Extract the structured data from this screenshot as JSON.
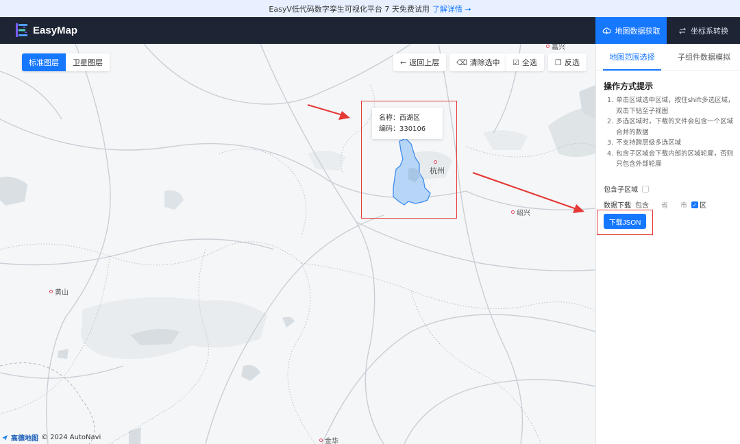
{
  "banner": {
    "text": "EasyV低代码数字孪生可视化平台 7 天免费试用",
    "link": "了解详情 →"
  },
  "app": {
    "name": "EasyMap"
  },
  "topbar": {
    "fetch_label": "地图数据获取",
    "coord_label": "坐标系转换"
  },
  "map": {
    "layers": {
      "standard": "标准图层",
      "satellite": "卫星图层",
      "active": "standard"
    },
    "buttons": {
      "back": "返回上层",
      "clear": "清除选中",
      "select_all": "全选",
      "invert": "反选"
    },
    "tooltip": {
      "name_line": "名称：西湖区",
      "code_line": "编码：330106"
    },
    "places": {
      "hangzhou": "杭州",
      "shaoxing": "绍兴",
      "huangshan": "黄山",
      "jiaxing": "嘉兴",
      "jinhua": "金华"
    },
    "credit": {
      "brand": "高德地图",
      "copyright": "© 2024 AutoNavi"
    }
  },
  "panel": {
    "tabs": [
      "地图范围选择",
      "子组件数据模拟"
    ],
    "active_tab": 0,
    "section_title": "操作方式提示",
    "tips": [
      "单击区域选中区域，按住shift多选区域，双击下钻至子视图",
      "多选区域时，下载的文件会包含一个区域合并的数据",
      "不支持跨层级多选区域",
      "包含子区域会下载内部的区域轮廓，否则只包含外部轮廓"
    ],
    "include_sub_label": "包含子区域",
    "include_sub_checked": false,
    "download_label": "数据下载",
    "include_label": "包含",
    "levels": [
      {
        "label": "省",
        "checked": false
      },
      {
        "label": "市",
        "checked": false
      },
      {
        "label": "区",
        "checked": true
      }
    ],
    "download_button": "下载JSON"
  },
  "colors": {
    "accent": "#1677ff",
    "topbar": "#1d2433",
    "highlight_fill": "#b7d6f7",
    "annotation": "#e53935"
  }
}
